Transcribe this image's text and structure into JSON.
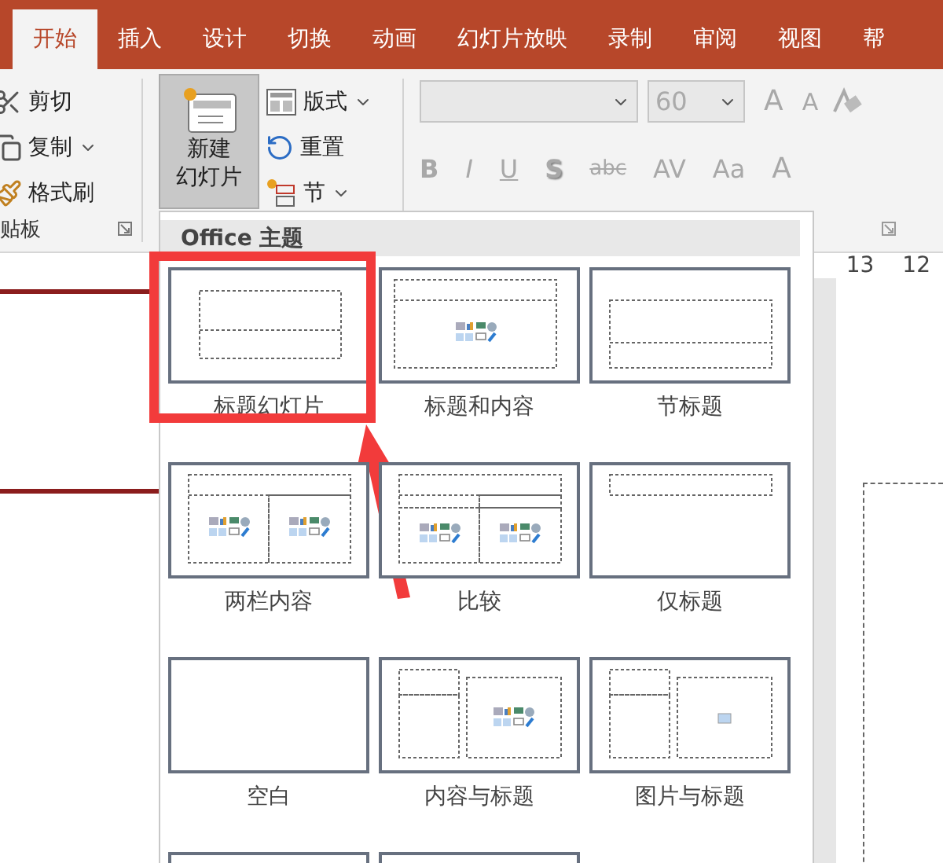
{
  "tabs": [
    {
      "label": "开始",
      "selected": true
    },
    {
      "label": "插入",
      "selected": false
    },
    {
      "label": "设计",
      "selected": false
    },
    {
      "label": "切换",
      "selected": false
    },
    {
      "label": "动画",
      "selected": false
    },
    {
      "label": "幻灯片放映",
      "selected": false
    },
    {
      "label": "录制",
      "selected": false
    },
    {
      "label": "审阅",
      "selected": false
    },
    {
      "label": "视图",
      "selected": false
    },
    {
      "label": "帮",
      "selected": false
    }
  ],
  "clipboard": {
    "group_label": "贴板",
    "items": [
      {
        "label": "剪切",
        "kind": "cut",
        "dropdown": false
      },
      {
        "label": "复制",
        "kind": "copy",
        "dropdown": true
      },
      {
        "label": "格式刷",
        "kind": "brush",
        "dropdown": false
      }
    ]
  },
  "slides": {
    "new_slide": {
      "lines": [
        "新建",
        "幻灯片"
      ],
      "pressed": true
    },
    "items": [
      {
        "label": "版式",
        "kind": "layout",
        "dropdown": true
      },
      {
        "label": "重置",
        "kind": "reset",
        "dropdown": false
      },
      {
        "label": "节",
        "kind": "section",
        "dropdown": true
      }
    ]
  },
  "font": {
    "disabled": true,
    "size": "60",
    "tools": [
      {
        "label": "A",
        "kind": "grow"
      },
      {
        "label": "A",
        "kind": "shrink"
      },
      {
        "kind": "clear"
      }
    ],
    "format": [
      {
        "label": "B",
        "kind": "bold"
      },
      {
        "label": "I",
        "kind": "italic"
      },
      {
        "label": "U",
        "kind": "underline"
      },
      {
        "label": "S",
        "kind": "shadow"
      },
      {
        "label": "abc",
        "kind": "strike"
      },
      {
        "label": "AV",
        "kind": "spacing"
      },
      {
        "label": "Aa",
        "kind": "case"
      },
      {
        "label": "A",
        "kind": "color"
      }
    ]
  },
  "ruler": [
    "13",
    "12"
  ],
  "gallery": {
    "title": "Office 主题",
    "layouts": [
      {
        "label": "标题幻灯片",
        "kind": "title",
        "highlighted": true
      },
      {
        "label": "标题和内容",
        "kind": "title-content",
        "highlighted": false
      },
      {
        "label": "节标题",
        "kind": "section",
        "highlighted": false
      },
      {
        "label": "两栏内容",
        "kind": "two-content",
        "highlighted": false
      },
      {
        "label": "比较",
        "kind": "comparison",
        "highlighted": false
      },
      {
        "label": "仅标题",
        "kind": "title-only",
        "highlighted": false
      },
      {
        "label": "空白",
        "kind": "blank",
        "highlighted": false
      },
      {
        "label": "内容与标题",
        "kind": "content-caption",
        "highlighted": false
      },
      {
        "label": "图片与标题",
        "kind": "picture-caption",
        "highlighted": false
      },
      {
        "kind": "title-vertical",
        "highlighted": false
      },
      {
        "kind": "vertical-title",
        "highlighted": false
      }
    ]
  }
}
